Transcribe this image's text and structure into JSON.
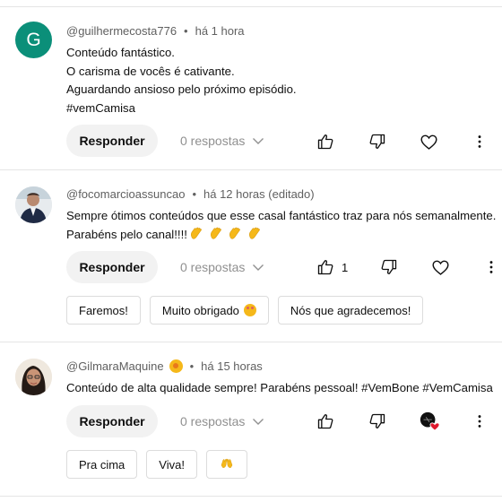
{
  "comments": [
    {
      "avatar_letter": "G",
      "avatar_color": "#0b8f79",
      "handle": "@guilhermecosta776",
      "separator": "•",
      "time": "há 1 hora",
      "lines": [
        "Conteúdo fantástico.",
        "O carisma de vocês é cativante.",
        "Aguardando ansioso pelo próximo episódio.",
        "#vemCamisa"
      ],
      "reply_label": "Responder",
      "replies_label": "0 respostas"
    },
    {
      "handle": "@focomarcioassuncao",
      "separator": "•",
      "time": "há 12 horas (editado)",
      "lines": [
        "Sempre ótimos conteúdos que esse casal fantástico traz para nós semanalmente.",
        "Parabéns pelo canal!!!!"
      ],
      "reply_label": "Responder",
      "replies_label": "0 respostas",
      "like_count": "1",
      "quick_replies": [
        "Faremos!",
        "Muito obrigado",
        "Nós que agradecemos!"
      ]
    },
    {
      "handle": "@GilmaraMaquine",
      "separator": "•",
      "time": "há 15 horas",
      "lines": [
        "Conteúdo de alta qualidade sempre! Parabéns pessoal! #VemBone #VemCamisa"
      ],
      "reply_label": "Responder",
      "replies_label": "0 respostas",
      "quick_replies": [
        "Pra cima",
        "Viva!"
      ]
    }
  ],
  "icons": {
    "like": "thumbs-up-icon",
    "dislike": "thumbs-down-icon",
    "heart": "heart-icon",
    "more": "more-vert-icon",
    "chevron": "chevron-down-icon",
    "clap": "clapping-hands-icon",
    "raised_hands": "raised-hands-icon",
    "creator_heart": "creator-heart-icon"
  },
  "colors": {
    "text_primary": "#0f0f0f",
    "text_secondary": "#606060",
    "reply_bg": "#f2f2f2",
    "divider": "#e5e5e5",
    "heart_red": "#e0192d"
  }
}
